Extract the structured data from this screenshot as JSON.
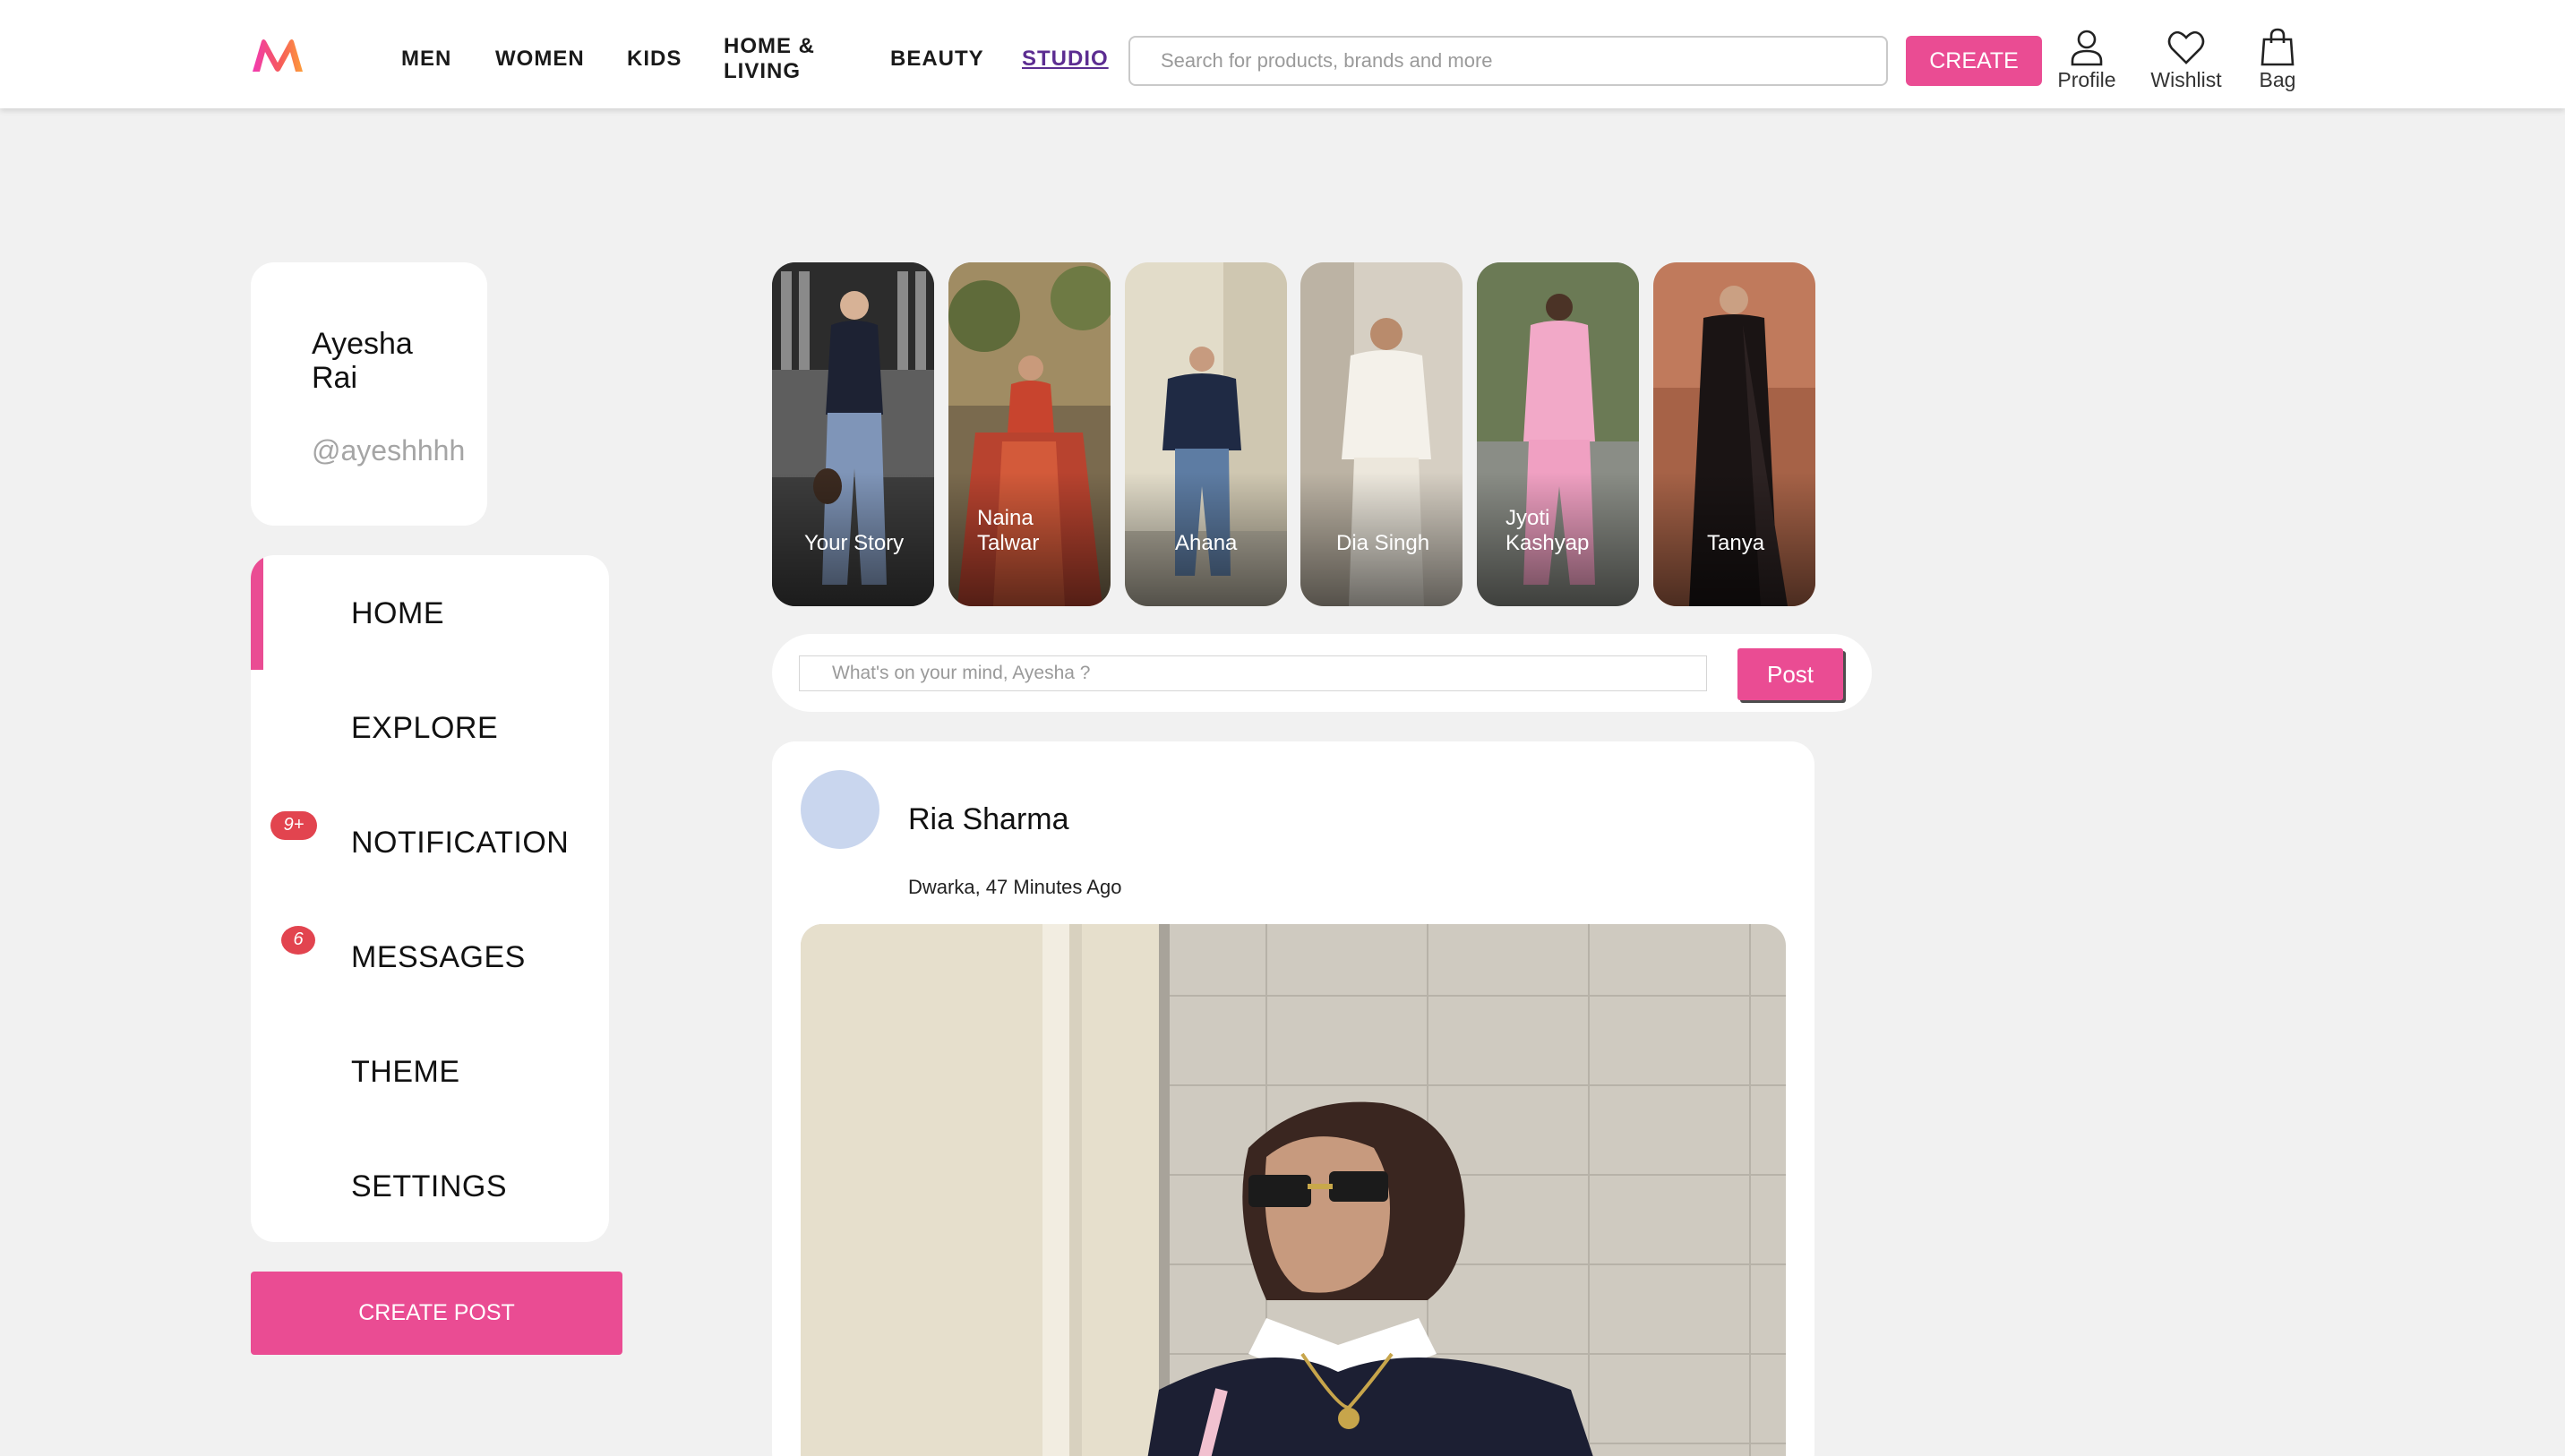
{
  "header": {
    "nav": [
      "MEN",
      "WOMEN",
      "KIDS",
      "HOME &\nLIVING",
      "BEAUTY",
      "STUDIO"
    ],
    "active_nav": "STUDIO",
    "search_placeholder": "Search for products, brands and more",
    "create_label": "CREATE",
    "icons": [
      {
        "label": "Profile",
        "icon": "profile-icon"
      },
      {
        "label": "Wishlist",
        "icon": "heart-icon"
      },
      {
        "label": "Bag",
        "icon": "bag-icon"
      }
    ]
  },
  "profile": {
    "name": "Ayesha Rai",
    "handle": "@ayeshhhh"
  },
  "menu": {
    "items": [
      {
        "label": "HOME",
        "active": true
      },
      {
        "label": "EXPLORE"
      },
      {
        "label": "NOTIFICATION",
        "badge": "9+"
      },
      {
        "label": "MESSAGES",
        "badge": "6"
      },
      {
        "label": "THEME"
      },
      {
        "label": "SETTINGS"
      }
    ],
    "create_post_label": "CREATE POST"
  },
  "stories": [
    {
      "name": "Your Story"
    },
    {
      "name": "Naina Talwar"
    },
    {
      "name": "Ahana"
    },
    {
      "name": "Dia Singh"
    },
    {
      "name": "Jyoti Kashyap"
    },
    {
      "name": "Tanya"
    }
  ],
  "composer": {
    "placeholder": "What's on your mind, Ayesha ?",
    "post_label": "Post"
  },
  "post": {
    "author": "Ria Sharma",
    "meta": "Dwarka, 47 Minutes Ago"
  },
  "colors": {
    "accent": "#ea4c93",
    "badge": "#e2444f",
    "studio": "#5c2d91",
    "background": "#f1f1f1"
  }
}
